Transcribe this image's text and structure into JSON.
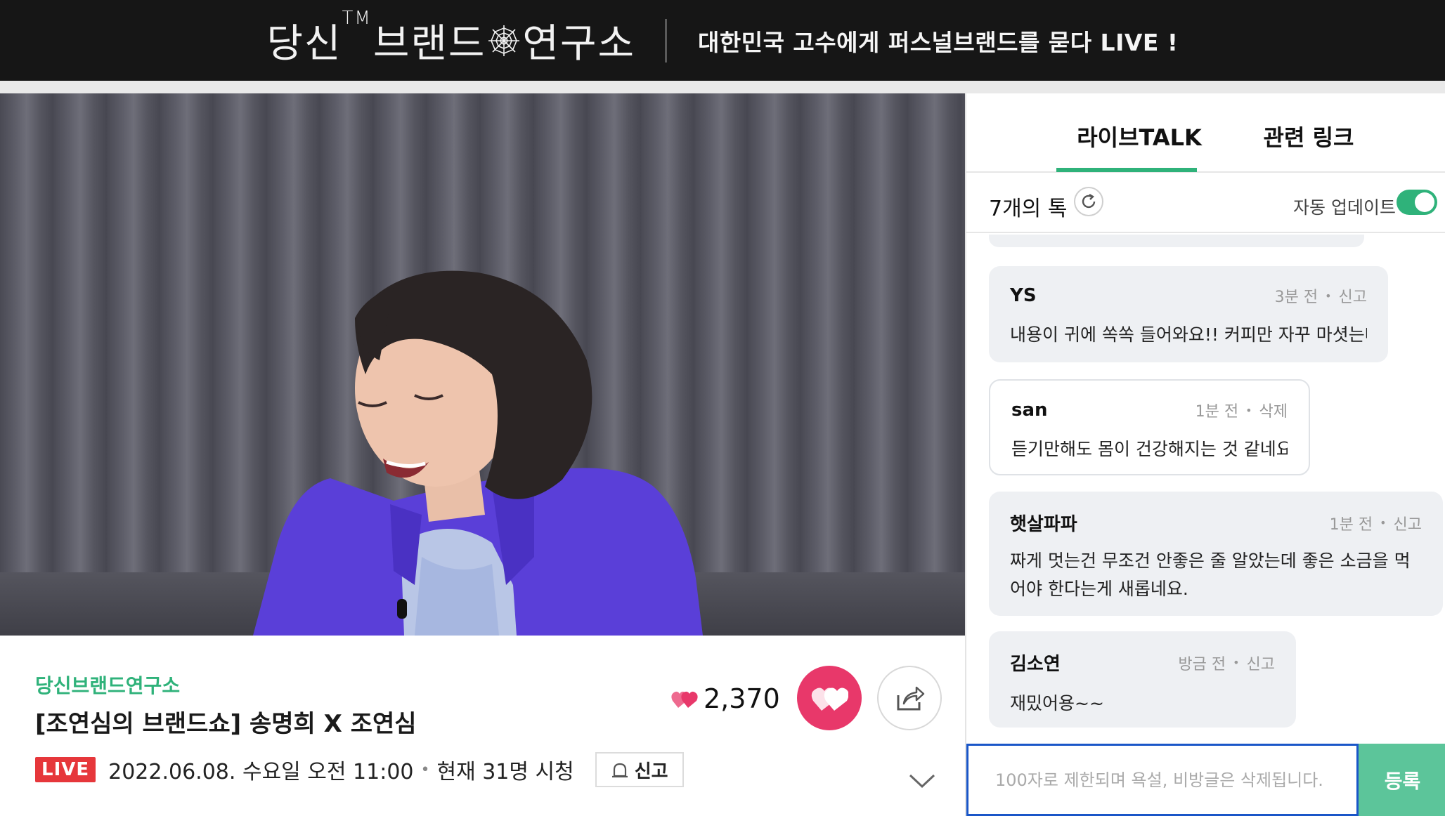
{
  "banner": {
    "brand_part1": "당신",
    "brand_tm": "TM",
    "brand_part2": "브랜드",
    "brand_part3": "연구소",
    "tagline": "대한민국 고수에게 퍼스널브랜드를 묻다 LIVE !"
  },
  "video": {
    "channel": "당신브랜드연구소",
    "title": "[조연심의 브랜드쇼] 송명희 X 조연심",
    "live_badge": "LIVE",
    "date": "2022.06.08. 수요일 오전 11:00",
    "viewers": "현재 31명 시청",
    "report_label": "신고",
    "like_count": "2,370"
  },
  "chat": {
    "tabs": [
      {
        "label": "라이브TALK",
        "active": true
      },
      {
        "label": "관련 링크",
        "active": false
      }
    ],
    "talk_count": "7개의 톡",
    "auto_update_label": "자동 업데이트",
    "auto_update_on": true,
    "messages": [
      {
        "author": "YS",
        "time": "3분 전",
        "action": "신고",
        "text": "내용이 귀에 쏙쏙 들어와요!! 커피만 자꾸 마셧는데 ㅈ",
        "mine": false
      },
      {
        "author": "san",
        "time": "1분 전",
        "action": "삭제",
        "text": "듣기만해도 몸이 건강해지는 것 같네요~!!",
        "mine": true
      },
      {
        "author": "햇살파파",
        "time": "1분 전",
        "action": "신고",
        "text": "짜게 멋는건 무조건 안좋은 줄 알았는데 좋은 소금을 먹어야 한다는게 새롭네요.",
        "mine": false
      },
      {
        "author": "김소연",
        "time": "방금 전",
        "action": "신고",
        "text": "재밌어용~~",
        "mine": false
      }
    ],
    "input_placeholder": "100자로 제한되며 욕설, 비방글은 삭제됩니다.",
    "submit_label": "등록"
  },
  "colors": {
    "accent_green": "#2fb27a",
    "like_pink": "#e8386a",
    "live_red": "#e6373b",
    "banner_bg": "#161616"
  }
}
